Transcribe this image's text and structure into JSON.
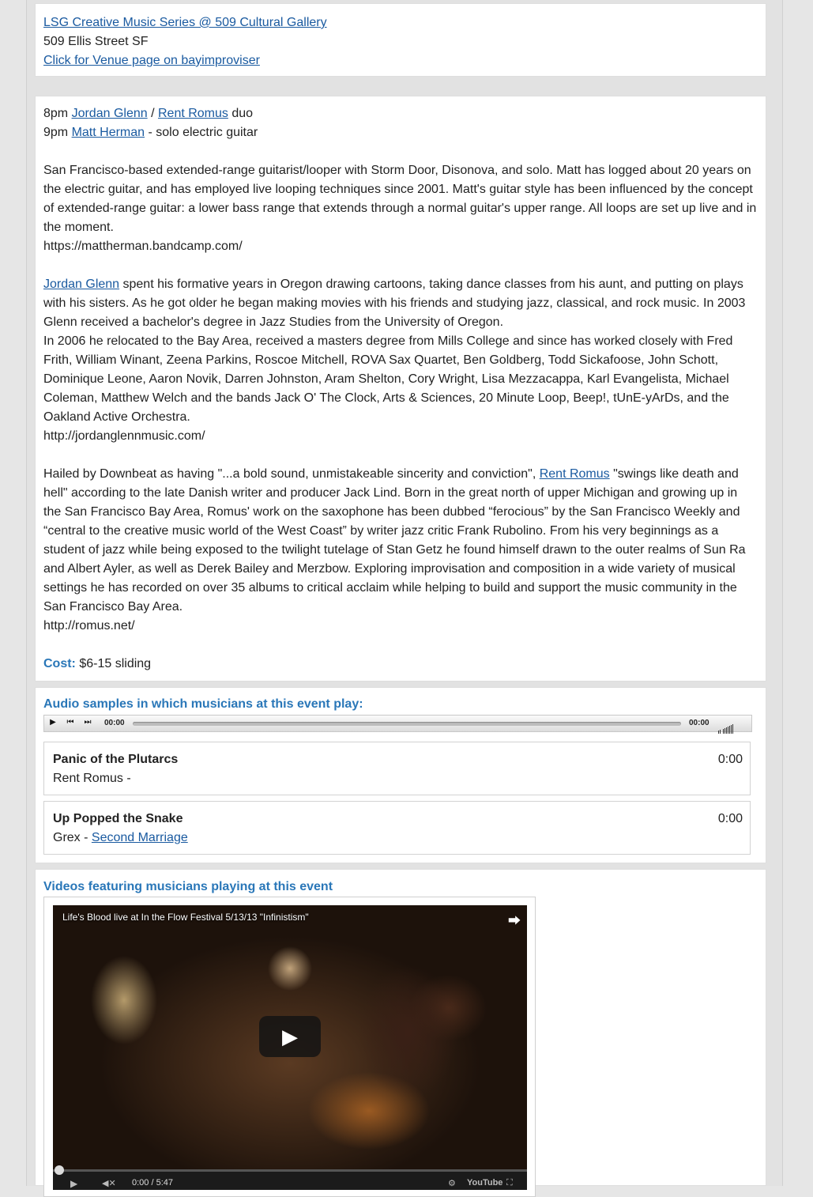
{
  "venue": {
    "series_link": "LSG Creative Music Series @ 509 Cultural Gallery",
    "address": "509 Ellis Street SF",
    "venue_link": "Click for Venue page on bayimproviser"
  },
  "lineup": {
    "line1_time": "8pm ",
    "line1_artist1": "Jordan Glenn",
    "line1_sep": " / ",
    "line1_artist2": "Rent Romus",
    "line1_suffix": " duo",
    "line2_time": "9pm ",
    "line2_artist": "Matt Herman",
    "line2_suffix": " - solo electric guitar"
  },
  "bios": {
    "matt_text": "San Francisco-based extended-range guitarist/looper with Storm Door, Disonova, and solo. Matt has logged about 20 years on the electric guitar, and has employed live looping techniques since 2001. Matt's guitar style has been influenced by the concept of extended-range guitar: a lower bass range that extends through a normal guitar's upper range. All loops are set up live and in the moment.",
    "matt_url": "https://mattherman.bandcamp.com/",
    "jordan_link": "Jordan Glenn",
    "jordan_text1": " spent his formative years in Oregon drawing cartoons, taking dance classes from his aunt, and putting on plays with his sisters. As he got older he began making movies with his friends and studying jazz, classical, and rock music. In 2003 Glenn received a bachelor's degree in Jazz Studies from the University of Oregon.",
    "jordan_text2": "In 2006 he relocated to the Bay Area, received a masters degree from Mills College and since has worked closely with Fred Frith, William Winant, Zeena Parkins, Roscoe Mitchell, ROVA Sax Quartet, Ben Goldberg, Todd Sickafoose, John Schott, Dominique Leone, Aaron Novik, Darren Johnston, Aram Shelton, Cory Wright, Lisa Mezzacappa, Karl Evangelista, Michael Coleman, Matthew Welch and the bands Jack O' The Clock, Arts & Sciences, 20 Minute Loop, Beep!, tUnE-yArDs, and the Oakland Active Orchestra.",
    "jordan_url": "http://jordanglennmusic.com/",
    "rent_text_before": "Hailed by Downbeat as having \"...a bold sound, unmistakeable sincerity and conviction\", ",
    "rent_link": "Rent Romus",
    "rent_text_after": " \"swings like death and hell\" according to the late Danish writer and producer Jack Lind. Born in the great north of upper Michigan and growing up in the San Francisco Bay Area, Romus' work on the saxophone has been dubbed “ferocious” by the San Francisco Weekly and “central to the creative music world of the West Coast” by writer jazz critic Frank Rubolino. From his very beginnings as a student of jazz while being exposed to the twilight tutelage of Stan Getz he found himself drawn to the outer realms of Sun Ra and Albert Ayler, as well as Derek Bailey and Merzbow. Exploring improvisation and composition in a wide variety of musical settings he has recorded on over 35 albums to critical acclaim while helping to build and support the music community in the San Francisco Bay Area.",
    "rent_url": "http://romus.net/"
  },
  "cost": {
    "label": "Cost:",
    "value": " $6-15 sliding"
  },
  "audio": {
    "heading": "Audio samples in which musicians at this event play:",
    "player": {
      "time_elapsed": "00:00",
      "time_total": "00:00"
    },
    "tracks": [
      {
        "title": "Panic of the Plutarcs",
        "artist": "Rent Romus -",
        "album": "",
        "time": "0:00"
      },
      {
        "title": "Up Popped the Snake",
        "artist": "Grex - ",
        "album": "Second Marriage",
        "time": "0:00"
      }
    ]
  },
  "videos": {
    "heading": "Videos featuring musicians playing at this event",
    "video_title": "Life's Blood live at In the Flow Festival 5/13/13 \"Infinistism\"",
    "time": "0:00 / 5:47",
    "brand": "YouTube"
  }
}
